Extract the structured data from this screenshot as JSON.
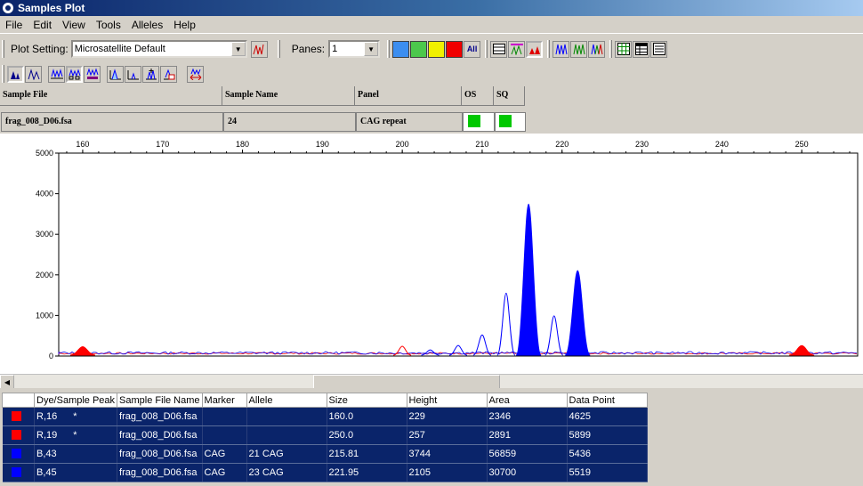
{
  "window": {
    "title": "Samples Plot"
  },
  "menu": [
    "File",
    "Edit",
    "View",
    "Tools",
    "Alleles",
    "Help"
  ],
  "toolbar": {
    "plot_setting_label": "Plot Setting:",
    "plot_setting_value": "Microsatellite Default",
    "panes_label": "Panes:",
    "panes_value": "1",
    "all_label": "All",
    "dye_colors": [
      "#3c8ef0",
      "#4cc84c",
      "#f0f000",
      "#f00000"
    ]
  },
  "sample_header": {
    "sample_file": "Sample File",
    "sample_name": "Sample Name",
    "panel": "Panel",
    "os": "OS",
    "sq": "SQ"
  },
  "sample_row": {
    "sample_file": "frag_008_D06.fsa",
    "sample_name": "24",
    "panel": "CAG repeat",
    "os_color": "#00c800",
    "sq_color": "#00c800"
  },
  "chart_data": {
    "type": "line",
    "x_ticks": [
      "160",
      "170",
      "180",
      "190",
      "200",
      "210",
      "220",
      "230",
      "240",
      "250"
    ],
    "y_ticks": [
      "0",
      "1000",
      "2000",
      "3000",
      "4000",
      "5000"
    ],
    "xlim": [
      157,
      257
    ],
    "ylim": [
      0,
      5000
    ],
    "series": [
      {
        "color": "#0000ff",
        "peaks": [
          {
            "x": 203.5,
            "y": 150,
            "filled": false
          },
          {
            "x": 207,
            "y": 260,
            "filled": false
          },
          {
            "x": 210,
            "y": 520,
            "filled": false
          },
          {
            "x": 213,
            "y": 1550,
            "filled": false
          },
          {
            "x": 215.81,
            "y": 3744,
            "filled": true
          },
          {
            "x": 219,
            "y": 990,
            "filled": false
          },
          {
            "x": 221.95,
            "y": 2105,
            "filled": true
          }
        ]
      },
      {
        "color": "#ff0000",
        "peaks": [
          {
            "x": 160.0,
            "y": 229,
            "filled": true
          },
          {
            "x": 200,
            "y": 240,
            "filled": false
          },
          {
            "x": 250.0,
            "y": 257,
            "filled": true
          }
        ]
      }
    ]
  },
  "peak_table": {
    "columns": [
      "Dye/Sample Peak",
      "Sample File Name",
      "Marker",
      "Allele",
      "Size",
      "Height",
      "Area",
      "Data Point"
    ],
    "rows": [
      {
        "dye_color": "#ff0000",
        "peak": "R,16",
        "flag": "*",
        "file": "frag_008_D06.fsa",
        "marker": "",
        "allele": "",
        "size": "160.0",
        "height": "229",
        "area": "2346",
        "data_point": "4625"
      },
      {
        "dye_color": "#ff0000",
        "peak": "R,19",
        "flag": "*",
        "file": "frag_008_D06.fsa",
        "marker": "",
        "allele": "",
        "size": "250.0",
        "height": "257",
        "area": "2891",
        "data_point": "5899"
      },
      {
        "dye_color": "#0000ff",
        "peak": "B,43",
        "flag": "",
        "file": "frag_008_D06.fsa",
        "marker": "CAG",
        "allele": "21 CAG",
        "size": "215.81",
        "height": "3744",
        "area": "56859",
        "data_point": "5436"
      },
      {
        "dye_color": "#0000ff",
        "peak": "B,45",
        "flag": "",
        "file": "frag_008_D06.fsa",
        "marker": "CAG",
        "allele": "23 CAG",
        "size": "221.95",
        "height": "2105",
        "area": "30700",
        "data_point": "5519"
      }
    ]
  }
}
